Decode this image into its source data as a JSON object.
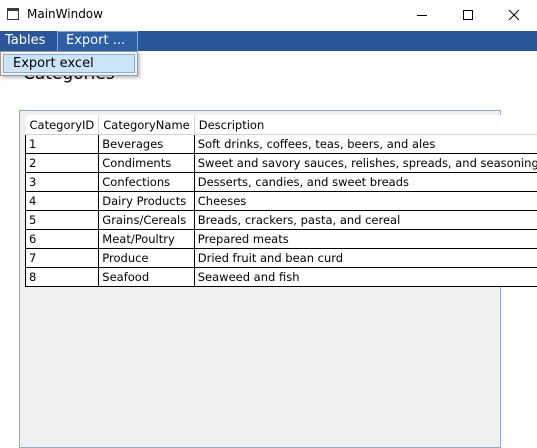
{
  "window": {
    "title": "MainWindow"
  },
  "menu": {
    "items": [
      {
        "label": "Tables"
      },
      {
        "label": "Export ..."
      }
    ],
    "export_dropdown": [
      {
        "label": "Export excel"
      }
    ]
  },
  "page": {
    "heading": "Categories"
  },
  "grid": {
    "columns": [
      "CategoryID",
      "CategoryName",
      "Description"
    ],
    "rows": [
      [
        "1",
        "Beverages",
        "Soft drinks, coffees, teas, beers, and ales"
      ],
      [
        "2",
        "Condiments",
        "Sweet and savory sauces, relishes, spreads, and seasonings"
      ],
      [
        "3",
        "Confections",
        "Desserts, candies, and sweet breads"
      ],
      [
        "4",
        "Dairy Products",
        "Cheeses"
      ],
      [
        "5",
        "Grains/Cereals",
        "Breads, crackers, pasta, and cereal"
      ],
      [
        "6",
        "Meat/Poultry",
        "Prepared meats"
      ],
      [
        "7",
        "Produce",
        "Dried fruit and bean curd"
      ],
      [
        "8",
        "Seafood",
        "Seaweed and fish"
      ]
    ]
  },
  "colors": {
    "menubar": "#2b579a",
    "selection": "#cce4f7",
    "panel": "#f0f0f0"
  }
}
